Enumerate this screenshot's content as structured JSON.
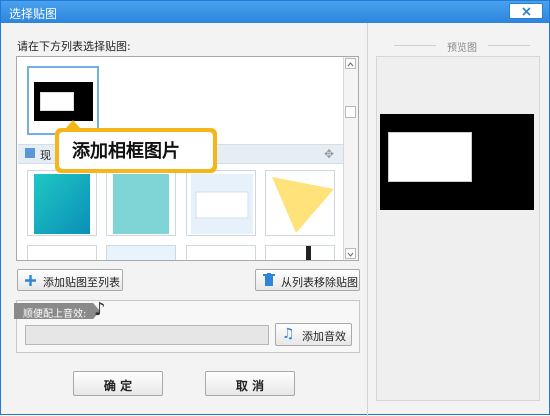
{
  "window": {
    "title": "选择贴图"
  },
  "list": {
    "label": "请在下方列表选择贴图:",
    "category": "现"
  },
  "tooltip": {
    "text": "添加相框图片"
  },
  "buttons": {
    "add": "添加贴图至列表",
    "remove": "从列表移除贴图",
    "add_sound": "添加音效",
    "ok": "确 定",
    "cancel": "取 消"
  },
  "sound": {
    "label": "顺便配上音效:",
    "value": ""
  },
  "preview": {
    "label": "预览图"
  },
  "colors": {
    "accent": "#2c85dc",
    "tooltip": "#f6b518"
  }
}
